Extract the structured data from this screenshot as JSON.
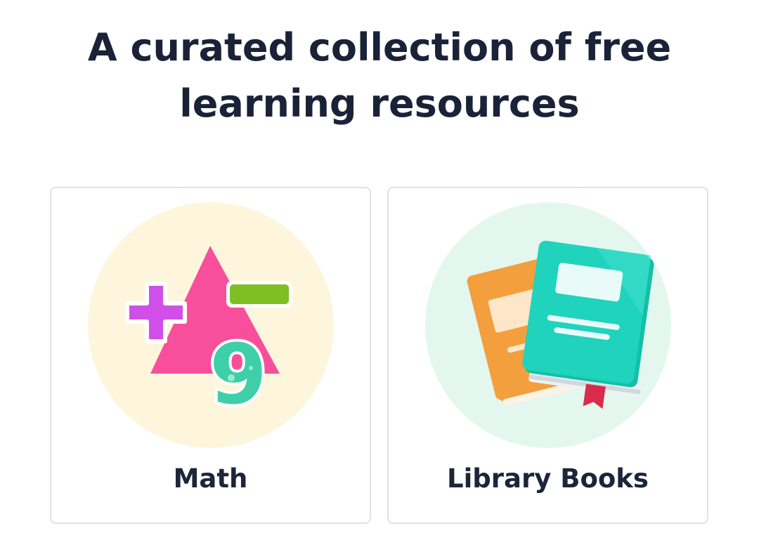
{
  "header": {
    "title": "A curated collection of free learning resources"
  },
  "cards": [
    {
      "label": "Math",
      "icon": "math-symbols-icon",
      "background_color": "#fef6dc",
      "accent_colors": [
        "#f74f9c",
        "#cf4fe8",
        "#7ec024",
        "#3ecfa9"
      ]
    },
    {
      "label": "Library Books",
      "icon": "books-icon",
      "background_color": "#e3f7ee",
      "accent_colors": [
        "#f39f3d",
        "#1fd3bd",
        "#d82c4b"
      ]
    }
  ]
}
